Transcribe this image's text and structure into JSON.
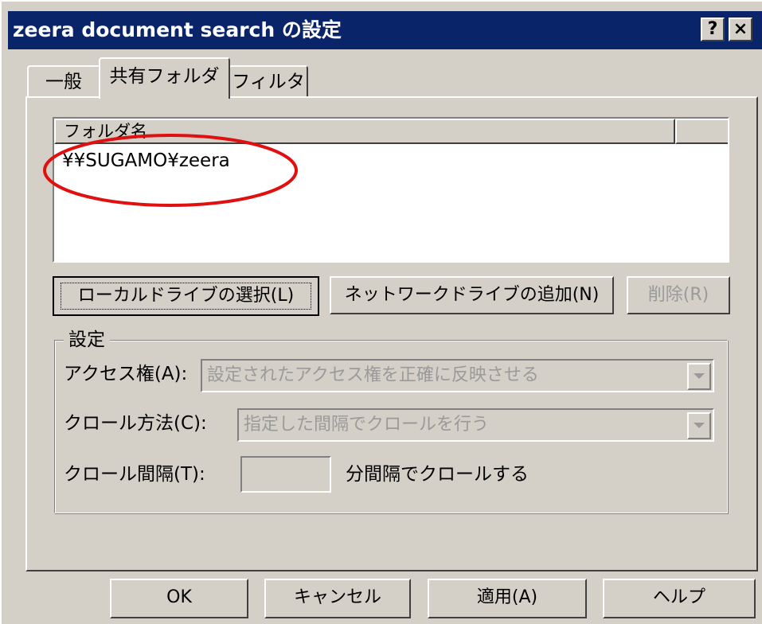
{
  "window": {
    "title": "zeera document search の設定",
    "help_glyph": "?",
    "close_glyph": "×"
  },
  "tabs": [
    {
      "label": "一般"
    },
    {
      "label": "共有フォルダ",
      "active": true
    },
    {
      "label": "フィルタ"
    }
  ],
  "folder_list": {
    "column_header": "フォルダ名",
    "items": [
      "¥¥SUGAMO¥zeera"
    ]
  },
  "folder_buttons": {
    "local": "ローカルドライブの選択(L)",
    "network": "ネットワークドライブの追加(N)",
    "delete": "削除(R)"
  },
  "settings": {
    "group_title": "設定",
    "access_label": "アクセス権(A):",
    "access_value": "設定されたアクセス権を正確に反映させる",
    "crawl_method_label": "クロール方法(C):",
    "crawl_method_value": "指定した間隔でクロールを行う",
    "crawl_interval_label": "クロール間隔(T):",
    "crawl_interval_value": "",
    "crawl_interval_suffix": "分間隔でクロールする"
  },
  "footer": {
    "ok": "OK",
    "cancel": "キャンセル",
    "apply": "適用(A)",
    "help": "ヘルプ"
  },
  "colors": {
    "titlebar": "#0a246a",
    "face": "#d4d0c8",
    "annotation": "#e01010",
    "disabled_text": "#9a9a9a"
  }
}
